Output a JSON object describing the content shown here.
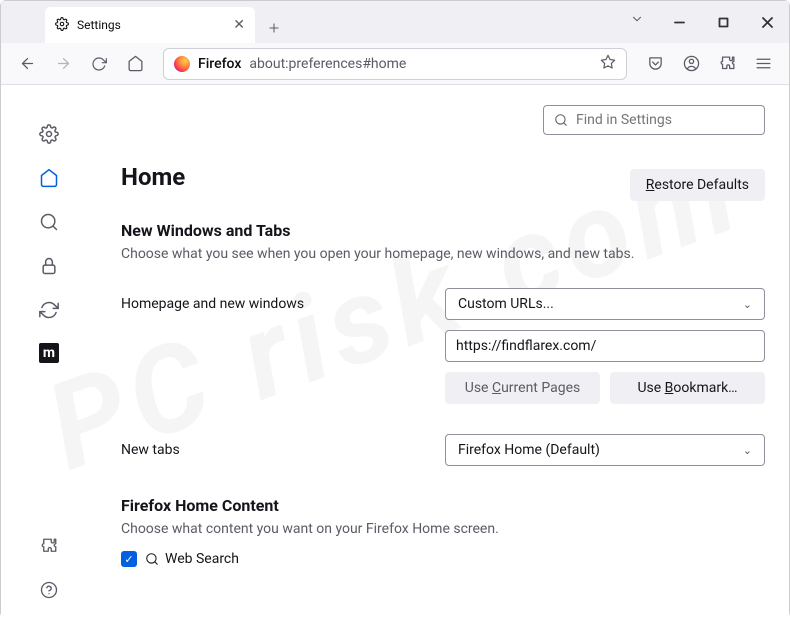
{
  "tab": {
    "title": "Settings"
  },
  "urlbar": {
    "identity": "Firefox",
    "path": "about:preferences#home"
  },
  "sidebar": {
    "items": [
      "general",
      "home",
      "search",
      "privacy",
      "sync",
      "more"
    ]
  },
  "search": {
    "placeholder": "Find in Settings"
  },
  "page": {
    "heading": "Home",
    "restore": "Restore Defaults",
    "section1_title": "New Windows and Tabs",
    "section1_desc": "Choose what you see when you open your homepage, new windows, and new tabs.",
    "homepage_label": "Homepage and new windows",
    "homepage_select": "Custom URLs...",
    "homepage_value": "https://findflarex.com/",
    "use_current": "Use Current Pages",
    "use_bookmark": "Use Bookmark…",
    "newtabs_label": "New tabs",
    "newtabs_select": "Firefox Home (Default)",
    "section2_title": "Firefox Home Content",
    "section2_desc": "Choose what content you want on your Firefox Home screen.",
    "websearch_label": "Web Search"
  }
}
